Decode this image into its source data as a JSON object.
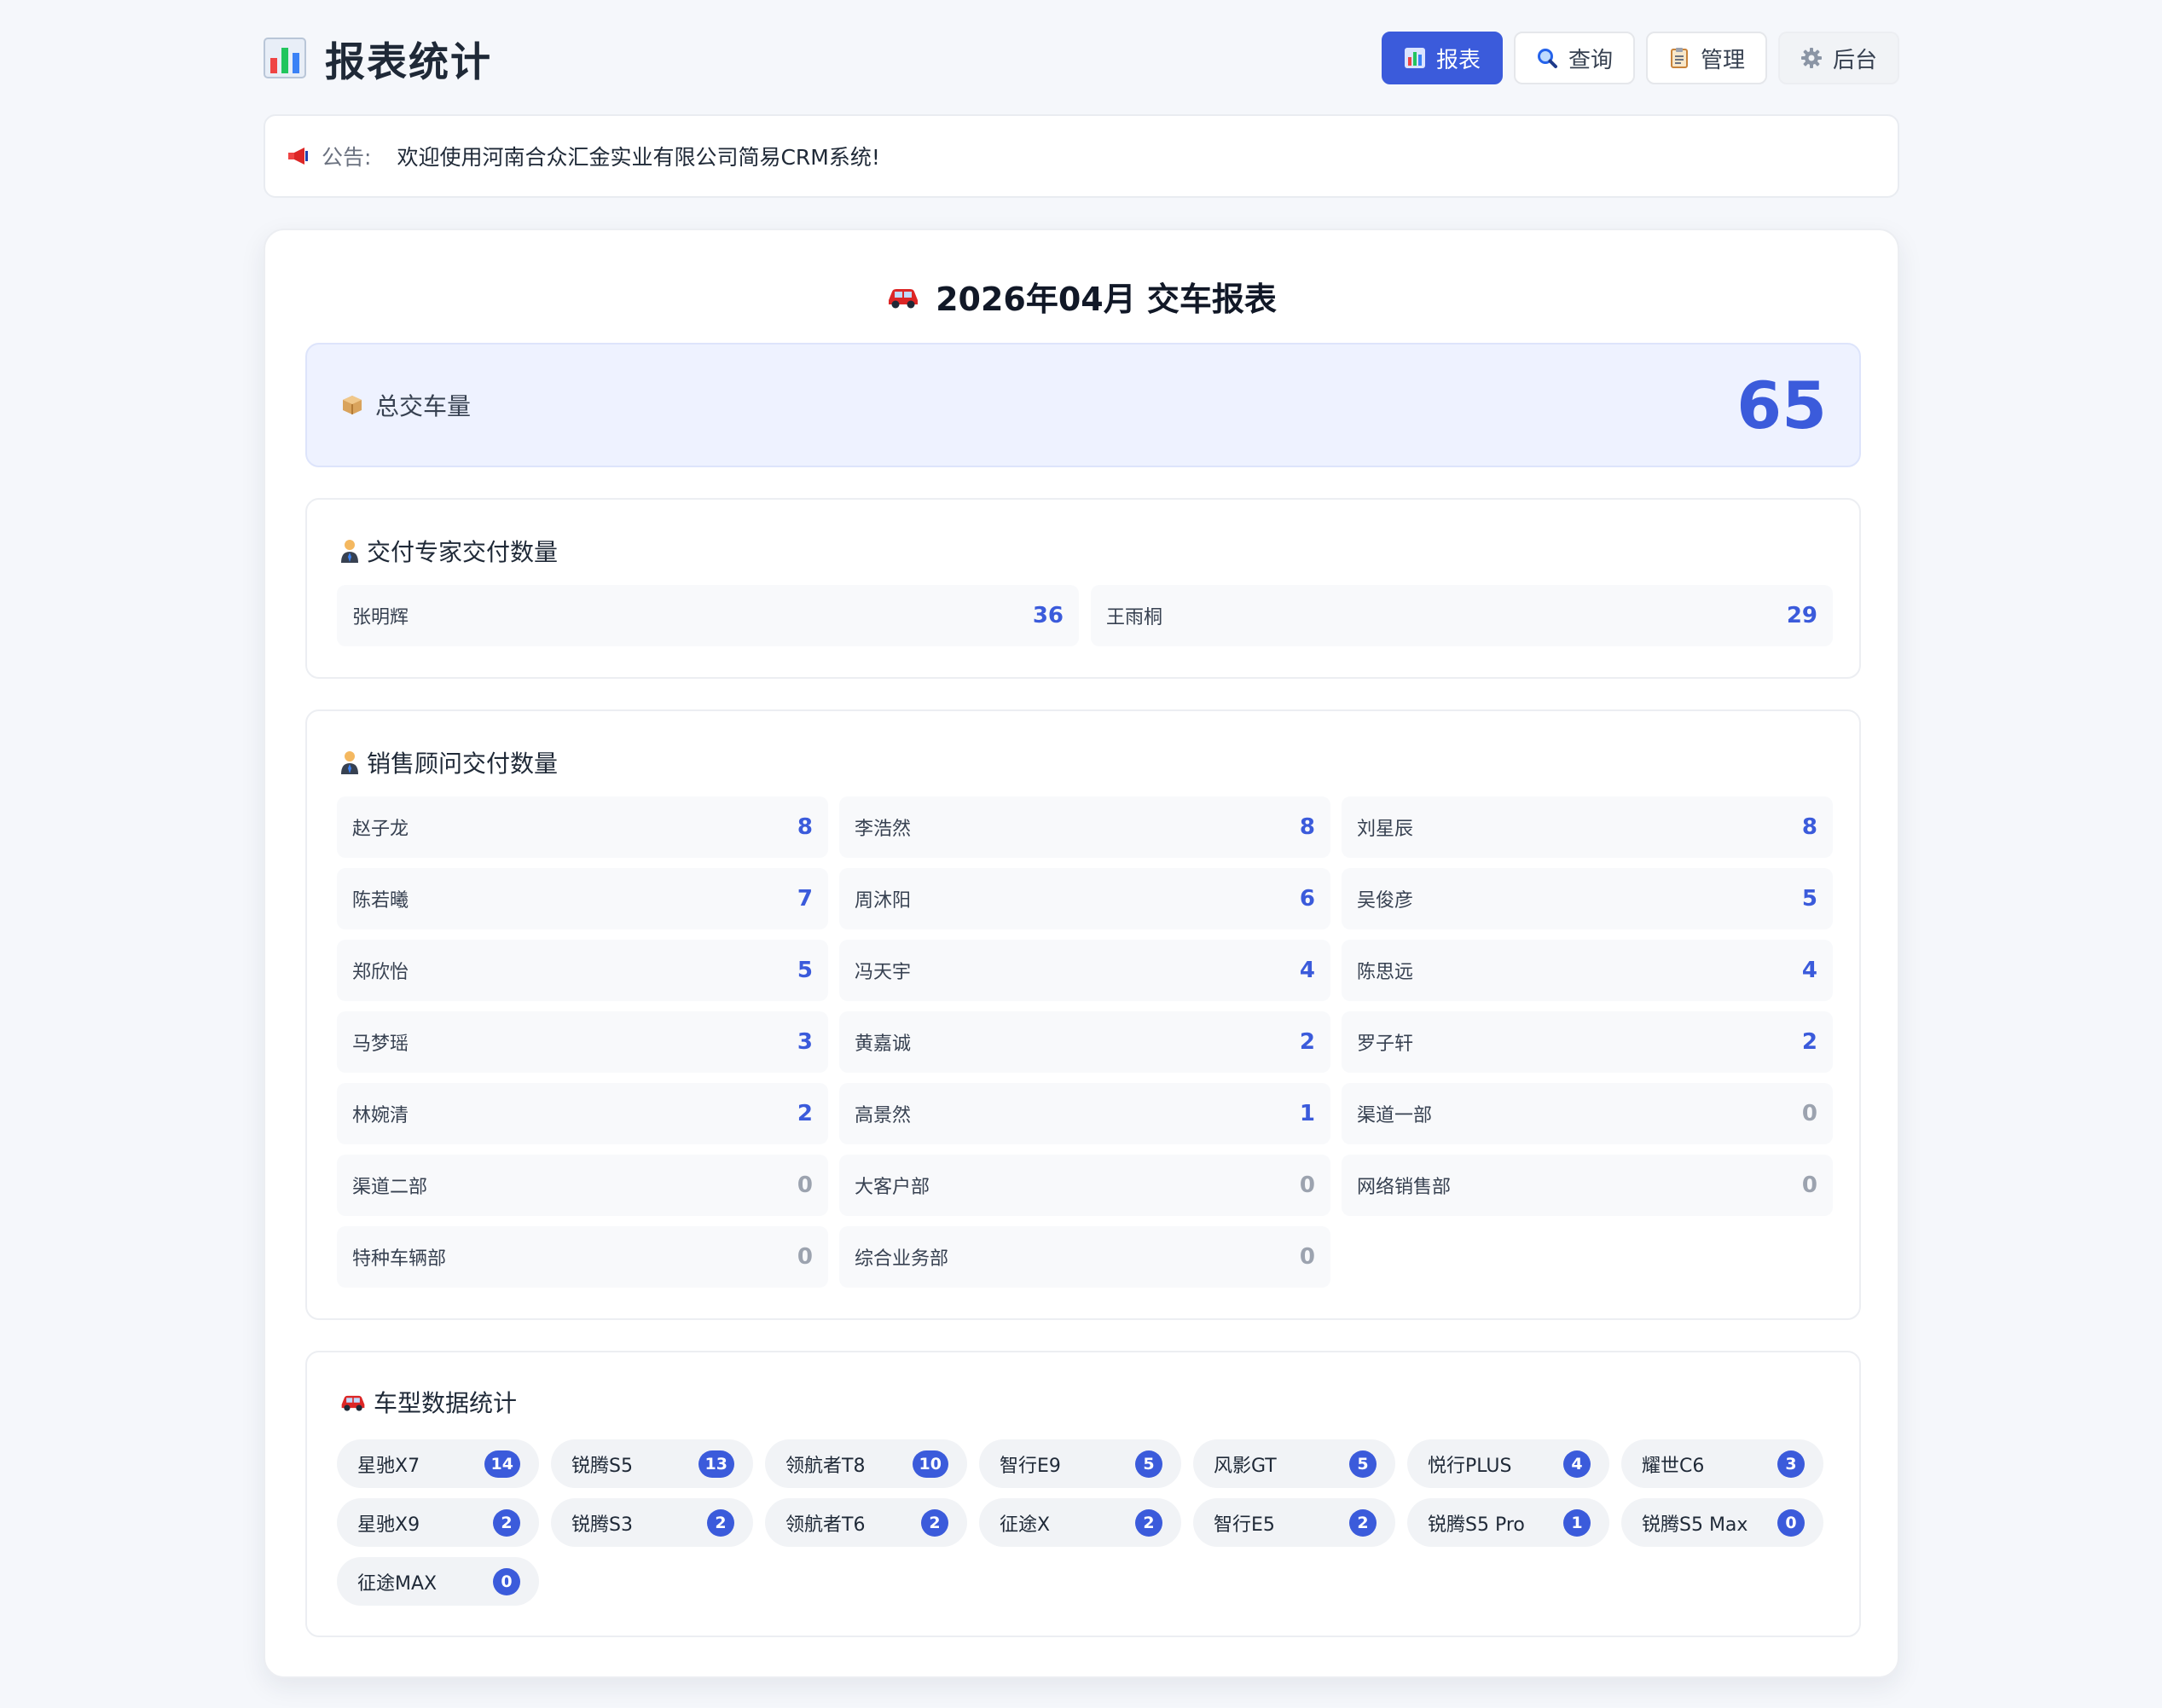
{
  "header": {
    "title": "报表统计",
    "nav": [
      {
        "label": "报表",
        "icon": "bar-chart-icon",
        "active": true
      },
      {
        "label": "查询",
        "icon": "search-icon",
        "active": false
      },
      {
        "label": "管理",
        "icon": "clipboard-icon",
        "active": false
      },
      {
        "label": "后台",
        "icon": "gear-icon",
        "active": false
      }
    ]
  },
  "notice": {
    "label": "公告:",
    "text": "欢迎使用河南合众汇金实业有限公司简易CRM系统!"
  },
  "report": {
    "title": "2026年04月 交车报表",
    "total_label": "总交车量",
    "total_value": "65",
    "experts": {
      "title": "交付专家交付数量",
      "items": [
        {
          "name": "张明辉",
          "value": "36"
        },
        {
          "name": "王雨桐",
          "value": "29"
        }
      ]
    },
    "advisors": {
      "title": "销售顾问交付数量",
      "items": [
        {
          "name": "赵子龙",
          "value": "8"
        },
        {
          "name": "李浩然",
          "value": "8"
        },
        {
          "name": "刘星辰",
          "value": "8"
        },
        {
          "name": "陈若曦",
          "value": "7"
        },
        {
          "name": "周沐阳",
          "value": "6"
        },
        {
          "name": "吴俊彦",
          "value": "5"
        },
        {
          "name": "郑欣怡",
          "value": "5"
        },
        {
          "name": "冯天宇",
          "value": "4"
        },
        {
          "name": "陈思远",
          "value": "4"
        },
        {
          "name": "马梦瑶",
          "value": "3"
        },
        {
          "name": "黄嘉诚",
          "value": "2"
        },
        {
          "name": "罗子轩",
          "value": "2"
        },
        {
          "name": "林婉清",
          "value": "2"
        },
        {
          "name": "高景然",
          "value": "1"
        },
        {
          "name": "渠道一部",
          "value": "0"
        },
        {
          "name": "渠道二部",
          "value": "0"
        },
        {
          "name": "大客户部",
          "value": "0"
        },
        {
          "name": "网络销售部",
          "value": "0"
        },
        {
          "name": "特种车辆部",
          "value": "0"
        },
        {
          "name": "综合业务部",
          "value": "0"
        }
      ]
    },
    "models": {
      "title": "车型数据统计",
      "items": [
        {
          "name": "星驰X7",
          "value": "14"
        },
        {
          "name": "锐腾S5",
          "value": "13"
        },
        {
          "name": "领航者T8",
          "value": "10"
        },
        {
          "name": "智行E9",
          "value": "5"
        },
        {
          "name": "风影GT",
          "value": "5"
        },
        {
          "name": "悦行PLUS",
          "value": "4"
        },
        {
          "name": "耀世C6",
          "value": "3"
        },
        {
          "name": "星驰X9",
          "value": "2"
        },
        {
          "name": "锐腾S3",
          "value": "2"
        },
        {
          "name": "领航者T6",
          "value": "2"
        },
        {
          "name": "征途X",
          "value": "2"
        },
        {
          "name": "智行E5",
          "value": "2"
        },
        {
          "name": "锐腾S5 Pro",
          "value": "1"
        },
        {
          "name": "锐腾S5 Max",
          "value": "0"
        },
        {
          "name": "征途MAX",
          "value": "0"
        }
      ]
    }
  },
  "colors": {
    "accent": "#3b5bdb",
    "background": "#f5f7fb",
    "total_box": "#eef2ff",
    "zero_value": "#9ca3af"
  }
}
